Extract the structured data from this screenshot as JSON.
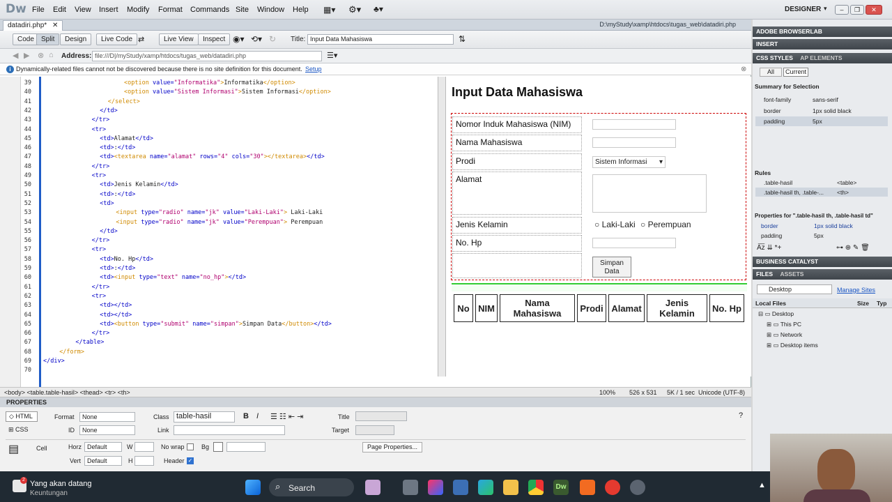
{
  "app": {
    "logo": "Dw",
    "menu": [
      "File",
      "Edit",
      "View",
      "Insert",
      "Modify",
      "Format",
      "Commands",
      "Site",
      "Window",
      "Help"
    ],
    "workspace": "DESIGNER"
  },
  "document": {
    "tab": "datadiri.php*",
    "path": "D:\\myStudy\\xamp\\htdocs\\tugas_web\\datadiri.php",
    "views": [
      "Code",
      "Split",
      "Design",
      "Live Code",
      "Live View",
      "Inspect"
    ],
    "title_label": "Title:",
    "title_value": "Input Data Mahasiswa",
    "address_label": "Address:",
    "address_value": "file:///D|/myStudy/xamp/htdocs/tugas_web/datadiri.php",
    "info": "Dynamically-related files cannot not be discovered because there is no site definition for this document.",
    "info_link": "Setup"
  },
  "code": {
    "lines": [
      {
        "n": "39",
        "indent": 20,
        "segs": [
          [
            "o",
            "<option "
          ],
          [
            "a",
            "value="
          ],
          [
            "v",
            "\"Informatika\""
          ],
          [
            "o",
            ">"
          ],
          [
            "tx",
            "Informatika"
          ],
          [
            "o",
            "</option>"
          ]
        ]
      },
      {
        "n": "40",
        "indent": 20,
        "segs": [
          [
            "o",
            "<option "
          ],
          [
            "a",
            "value="
          ],
          [
            "v",
            "\"Sistem Informasi\""
          ],
          [
            "o",
            ">"
          ],
          [
            "tx",
            "Sistem Informasi"
          ],
          [
            "o",
            "</option>"
          ]
        ]
      },
      {
        "n": "41",
        "indent": 16,
        "segs": [
          [
            "o",
            "</select>"
          ]
        ]
      },
      {
        "n": "42",
        "indent": 14,
        "segs": [
          [
            "t",
            "</td>"
          ]
        ]
      },
      {
        "n": "43",
        "indent": 12,
        "segs": [
          [
            "t",
            "</tr>"
          ]
        ]
      },
      {
        "n": "44",
        "indent": 12,
        "segs": [
          [
            "t",
            "<tr>"
          ]
        ]
      },
      {
        "n": "45",
        "indent": 14,
        "segs": [
          [
            "t",
            "<td>"
          ],
          [
            "tx",
            "Alamat"
          ],
          [
            "t",
            "</td>"
          ]
        ]
      },
      {
        "n": "46",
        "indent": 14,
        "segs": [
          [
            "t",
            "<td>"
          ],
          [
            "tx",
            ":"
          ],
          [
            "t",
            "</td>"
          ]
        ]
      },
      {
        "n": "47",
        "indent": 14,
        "segs": [
          [
            "t",
            "<td>"
          ],
          [
            "o",
            "<textarea "
          ],
          [
            "a",
            "name="
          ],
          [
            "v",
            "\"alamat\""
          ],
          [
            "a",
            " rows="
          ],
          [
            "v",
            "\"4\""
          ],
          [
            "a",
            " cols="
          ],
          [
            "v",
            "\"30\""
          ],
          [
            "o",
            "></textarea>"
          ],
          [
            "t",
            "</td>"
          ]
        ]
      },
      {
        "n": "48",
        "indent": 12,
        "segs": [
          [
            "t",
            "</tr>"
          ]
        ]
      },
      {
        "n": "49",
        "indent": 12,
        "segs": [
          [
            "t",
            "<tr>"
          ]
        ]
      },
      {
        "n": "50",
        "indent": 14,
        "segs": [
          [
            "t",
            "<td>"
          ],
          [
            "tx",
            "Jenis Kelamin"
          ],
          [
            "t",
            "</td>"
          ]
        ]
      },
      {
        "n": "51",
        "indent": 14,
        "segs": [
          [
            "t",
            "<td>"
          ],
          [
            "tx",
            ":"
          ],
          [
            "t",
            "</td>"
          ]
        ]
      },
      {
        "n": "52",
        "indent": 14,
        "segs": [
          [
            "t",
            "<td>"
          ]
        ]
      },
      {
        "n": "53",
        "indent": 18,
        "segs": [
          [
            "o",
            "<input "
          ],
          [
            "a",
            "type="
          ],
          [
            "v",
            "\"radio\""
          ],
          [
            "a",
            " name="
          ],
          [
            "v",
            "\"jk\""
          ],
          [
            "a",
            " value="
          ],
          [
            "v",
            "\"Laki-Laki\""
          ],
          [
            "o",
            ">"
          ],
          [
            "tx",
            " Laki-Laki"
          ]
        ]
      },
      {
        "n": "54",
        "indent": 18,
        "segs": [
          [
            "o",
            "<input "
          ],
          [
            "a",
            "type="
          ],
          [
            "v",
            "\"radio\""
          ],
          [
            "a",
            " name="
          ],
          [
            "v",
            "\"jk\""
          ],
          [
            "a",
            " value="
          ],
          [
            "v",
            "\"Perempuan\""
          ],
          [
            "o",
            ">"
          ],
          [
            "tx",
            " Perempuan"
          ]
        ]
      },
      {
        "n": "55",
        "indent": 14,
        "segs": [
          [
            "t",
            "</td>"
          ]
        ]
      },
      {
        "n": "56",
        "indent": 12,
        "segs": [
          [
            "t",
            "</tr>"
          ]
        ]
      },
      {
        "n": "57",
        "indent": 12,
        "segs": [
          [
            "t",
            "<tr>"
          ]
        ]
      },
      {
        "n": "58",
        "indent": 14,
        "segs": [
          [
            "t",
            "<td>"
          ],
          [
            "tx",
            "No. Hp"
          ],
          [
            "t",
            "</td>"
          ]
        ]
      },
      {
        "n": "59",
        "indent": 14,
        "segs": [
          [
            "t",
            "<td>"
          ],
          [
            "tx",
            ":"
          ],
          [
            "t",
            "</td>"
          ]
        ]
      },
      {
        "n": "60",
        "indent": 14,
        "segs": [
          [
            "t",
            "<td>"
          ],
          [
            "o",
            "<input "
          ],
          [
            "a",
            "type="
          ],
          [
            "v",
            "\"text\""
          ],
          [
            "a",
            " name="
          ],
          [
            "v",
            "\"no_hp\""
          ],
          [
            "o",
            ">"
          ],
          [
            "t",
            "</td>"
          ]
        ]
      },
      {
        "n": "61",
        "indent": 12,
        "segs": [
          [
            "t",
            "</tr>"
          ]
        ]
      },
      {
        "n": "62",
        "indent": 12,
        "segs": [
          [
            "t",
            "<tr>"
          ]
        ]
      },
      {
        "n": "63",
        "indent": 14,
        "segs": [
          [
            "t",
            "<td></td>"
          ]
        ]
      },
      {
        "n": "64",
        "indent": 14,
        "segs": [
          [
            "t",
            "<td></td>"
          ]
        ]
      },
      {
        "n": "65",
        "indent": 14,
        "segs": [
          [
            "t",
            "<td>"
          ],
          [
            "o",
            "<button "
          ],
          [
            "a",
            "type="
          ],
          [
            "v",
            "\"submit\""
          ],
          [
            "a",
            " name="
          ],
          [
            "v",
            "\"simpan\""
          ],
          [
            "o",
            ">"
          ],
          [
            "tx",
            "Simpan Data"
          ],
          [
            "o",
            "</button>"
          ],
          [
            "t",
            "</td>"
          ]
        ]
      },
      {
        "n": "66",
        "indent": 12,
        "segs": [
          [
            "t",
            "</tr>"
          ]
        ]
      },
      {
        "n": "67",
        "indent": 8,
        "segs": [
          [
            "t",
            "</table>"
          ]
        ]
      },
      {
        "n": "68",
        "indent": 4,
        "segs": [
          [
            "o",
            "</form>"
          ]
        ]
      },
      {
        "n": "69",
        "indent": 0,
        "segs": [
          [
            "t",
            "</div>"
          ]
        ]
      },
      {
        "n": "70",
        "indent": 0,
        "segs": []
      }
    ]
  },
  "design": {
    "heading": "Input Data Mahasiswa",
    "fields": [
      {
        "label": "Nomor Induk Mahasiswa (NIM)",
        "kind": "text"
      },
      {
        "label": "Nama Mahasiswa",
        "kind": "text"
      },
      {
        "label": "Prodi",
        "kind": "select",
        "selected": "Sistem Informasi"
      },
      {
        "label": "Alamat",
        "kind": "textarea"
      },
      {
        "label": "Jenis Kelamin",
        "kind": "radio",
        "options": [
          "Laki-Laki",
          "Perempuan"
        ]
      },
      {
        "label": "No. Hp",
        "kind": "text"
      }
    ],
    "submit": "Simpan Data",
    "table_headers": [
      "No",
      "NIM",
      "Nama Mahasiswa",
      "Prodi",
      "Alamat",
      "Jenis Kelamin",
      "No. Hp"
    ]
  },
  "status": {
    "tags": "<body> <table.table-hasil> <thead> <tr> <th>",
    "zoom": "100%",
    "size": "526 x 531",
    "speed": "5K / 1 sec",
    "encoding": "Unicode (UTF-8)"
  },
  "properties": {
    "title": "PROPERTIES",
    "html_tab": "HTML",
    "css_tab": "CSS",
    "format_label": "Format",
    "format_value": "None",
    "id_label": "ID",
    "id_value": "None",
    "class_label": "Class",
    "class_value": "table-hasil",
    "link_label": "Link",
    "title_label": "Title",
    "target_label": "Target",
    "cell_label": "Cell",
    "horz_label": "Horz",
    "horz_value": "Default",
    "vert_label": "Vert",
    "vert_value": "Default",
    "w_label": "W",
    "h_label": "H",
    "nowrap_label": "No wrap",
    "bg_label": "Bg",
    "header_label": "Header",
    "page_props": "Page Properties..."
  },
  "right_panel": {
    "browserlab": "ADOBE BROWSERLAB",
    "insert": "INSERT",
    "css_styles": "CSS STYLES",
    "ap_elements": "AP ELEMENTS",
    "all": "All",
    "current": "Current",
    "summary_title": "Summary for Selection",
    "summary": [
      [
        "font-family",
        "sans-serif"
      ],
      [
        "border",
        "1px solid black"
      ],
      [
        "padding",
        "5px"
      ]
    ],
    "rules_title": "Rules",
    "rules": [
      [
        ".table-hasil",
        "<table>"
      ],
      [
        ".table-hasil th, .table-...",
        "<th>"
      ]
    ],
    "props_title": "Properties for \".table-hasil th, .table-hasil td\"",
    "props": [
      [
        "border",
        "1px solid black"
      ],
      [
        "padding",
        "5px"
      ]
    ],
    "business": "BUSINESS CATALYST",
    "files": "FILES",
    "assets": "ASSETS",
    "site_select": "Desktop",
    "manage_sites": "Manage Sites",
    "local_files": "Local Files",
    "size_col": "Size",
    "type_col": "Typ",
    "tree": [
      "Desktop",
      "This PC",
      "Network",
      "Desktop items"
    ]
  },
  "taskbar": {
    "notif_title": "Yang akan datang",
    "notif_sub": "Keuntungan",
    "notif_badge": "2",
    "search": "Search"
  }
}
